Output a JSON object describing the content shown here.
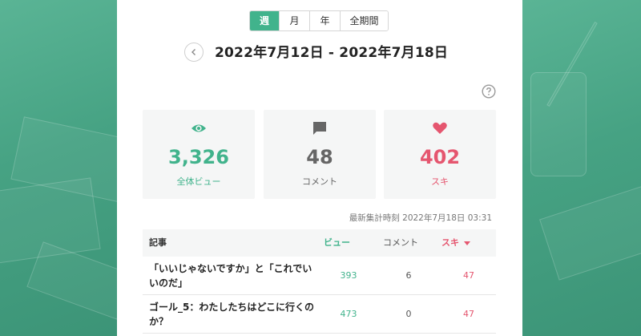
{
  "tabs": [
    {
      "label": "週",
      "active": true
    },
    {
      "label": "月",
      "active": false
    },
    {
      "label": "年",
      "active": false
    },
    {
      "label": "全期間",
      "active": false
    }
  ],
  "date_range": "2022年7月12日 - 2022年7月18日",
  "stats": {
    "views": {
      "value": "3,326",
      "label": "全体ビュー",
      "icon": "eye-icon",
      "color": "#41b38c"
    },
    "comments": {
      "value": "48",
      "label": "コメント",
      "icon": "comment-icon",
      "color": "#666666"
    },
    "likes": {
      "value": "402",
      "label": "スキ",
      "icon": "heart-icon",
      "color": "#e5566f"
    }
  },
  "updated_at": "最新集計時刻 2022年7月18日 03:31",
  "table": {
    "headers": {
      "title": "記事",
      "views": "ビュー",
      "comments": "コメント",
      "likes": "スキ"
    },
    "rows": [
      {
        "title": "「いいじゃないですか」と「これでいいのだ」",
        "views": "393",
        "comments": "6",
        "likes": "47"
      },
      {
        "title": "ゴール_5：わたしたちはどこに行くのか？",
        "views": "473",
        "comments": "0",
        "likes": "47"
      }
    ]
  }
}
